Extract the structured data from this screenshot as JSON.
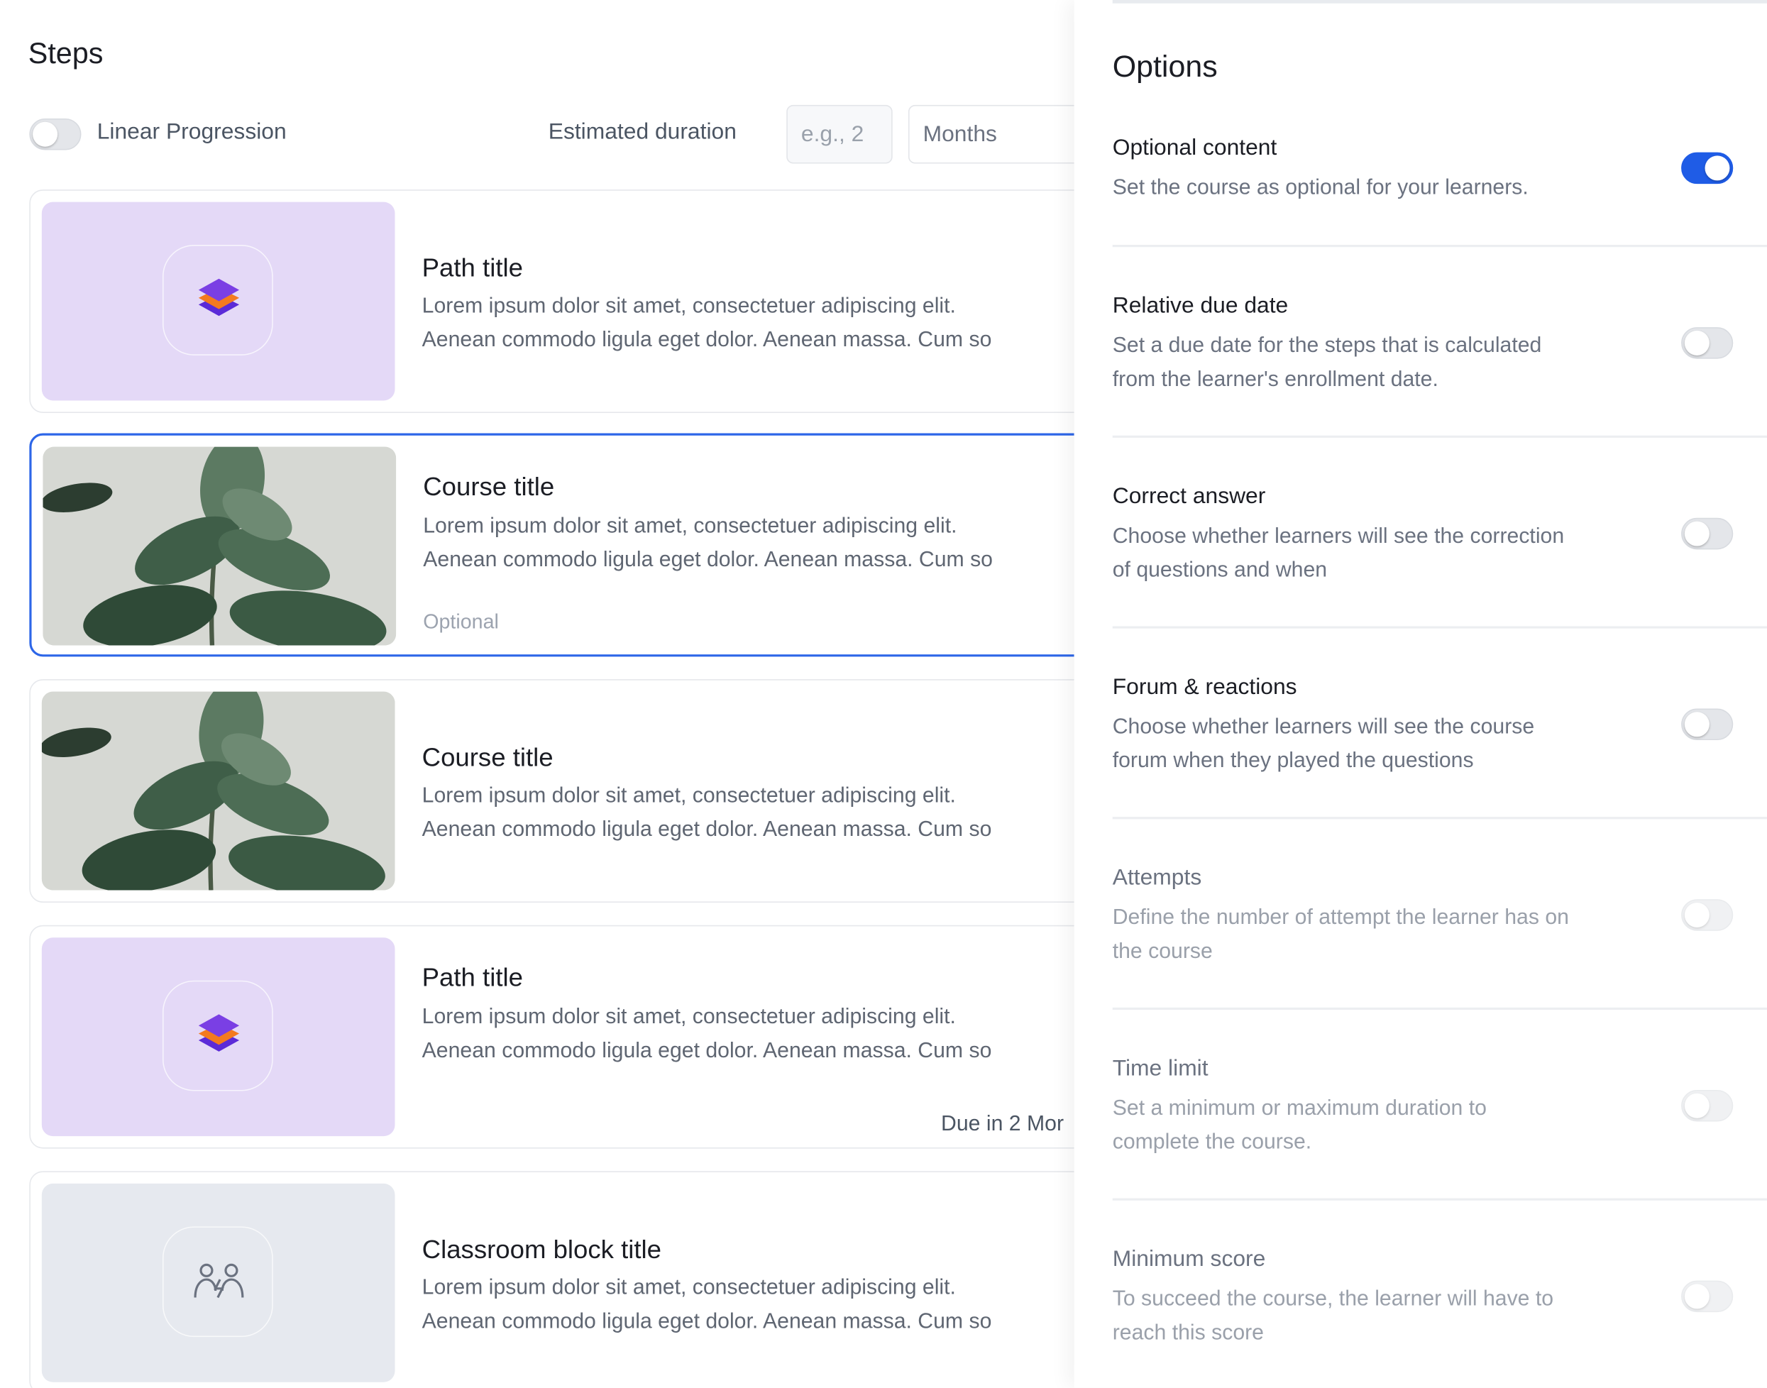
{
  "steps": {
    "title": "Steps",
    "linear_progression_label": "Linear Progression",
    "linear_progression_on": false,
    "estimated_duration_label": "Estimated duration",
    "duration_placeholder": "e.g., 2",
    "duration_unit": "Months",
    "cards": [
      {
        "kind": "path",
        "title": "Path title",
        "desc1": "Lorem ipsum dolor sit amet, consectetuer adipiscing elit.",
        "desc2": "Aenean commodo ligula eget dolor. Aenean massa. Cum so"
      },
      {
        "kind": "course",
        "title": "Course title",
        "desc1": "Lorem ipsum dolor sit amet, consectetuer adipiscing elit.",
        "desc2": "Aenean commodo ligula eget dolor. Aenean massa. Cum so",
        "tag": "Optional",
        "selected": true
      },
      {
        "kind": "course",
        "title": "Course title",
        "desc1": "Lorem ipsum dolor sit amet, consectetuer adipiscing elit.",
        "desc2": "Aenean commodo ligula eget dolor. Aenean massa. Cum so"
      },
      {
        "kind": "path",
        "title": "Path title",
        "desc1": "Lorem ipsum dolor sit amet, consectetuer adipiscing elit.",
        "desc2": "Aenean commodo ligula eget dolor. Aenean massa. Cum so",
        "due": "Due in 2 Mor"
      },
      {
        "kind": "classroom",
        "title": "Classroom block title",
        "desc1": "Lorem ipsum dolor sit amet, consectetuer adipiscing elit.",
        "desc2": "Aenean commodo ligula eget dolor. Aenean massa. Cum so"
      }
    ]
  },
  "options": {
    "title": "Options",
    "items": [
      {
        "title": "Optional content",
        "desc1": "Set the course as optional for your learners.",
        "desc2": "",
        "enabled": true,
        "disabled": false
      },
      {
        "title": "Relative due date",
        "desc1": "Set a due date for the steps that is calculated",
        "desc2": "from the learner's enrollment date.",
        "enabled": false,
        "disabled": false
      },
      {
        "title": "Correct answer",
        "desc1": "Choose whether learners will see the correction",
        "desc2": "of questions and when",
        "enabled": false,
        "disabled": false
      },
      {
        "title": "Forum & reactions",
        "desc1": "Choose whether learners will see the course",
        "desc2": "forum when they played the questions",
        "enabled": false,
        "disabled": false
      },
      {
        "title": "Attempts",
        "desc1": "Define the number of attempt the learner has on",
        "desc2": "the course",
        "enabled": false,
        "disabled": true
      },
      {
        "title": "Time limit",
        "desc1": "Set a minimum or maximum duration to",
        "desc2": "complete the course.",
        "enabled": false,
        "disabled": true
      },
      {
        "title": "Minimum score",
        "desc1": "To succeed the course, the learner will have to",
        "desc2": "reach this score",
        "enabled": false,
        "disabled": true
      }
    ]
  },
  "colors": {
    "accent": "#1f5ce6",
    "path_thumb": "#e4d9f7",
    "classroom_thumb": "#e6e9ef"
  },
  "icons": {
    "path": "layers-icon",
    "classroom": "people-icon",
    "course": "plant-photo"
  }
}
